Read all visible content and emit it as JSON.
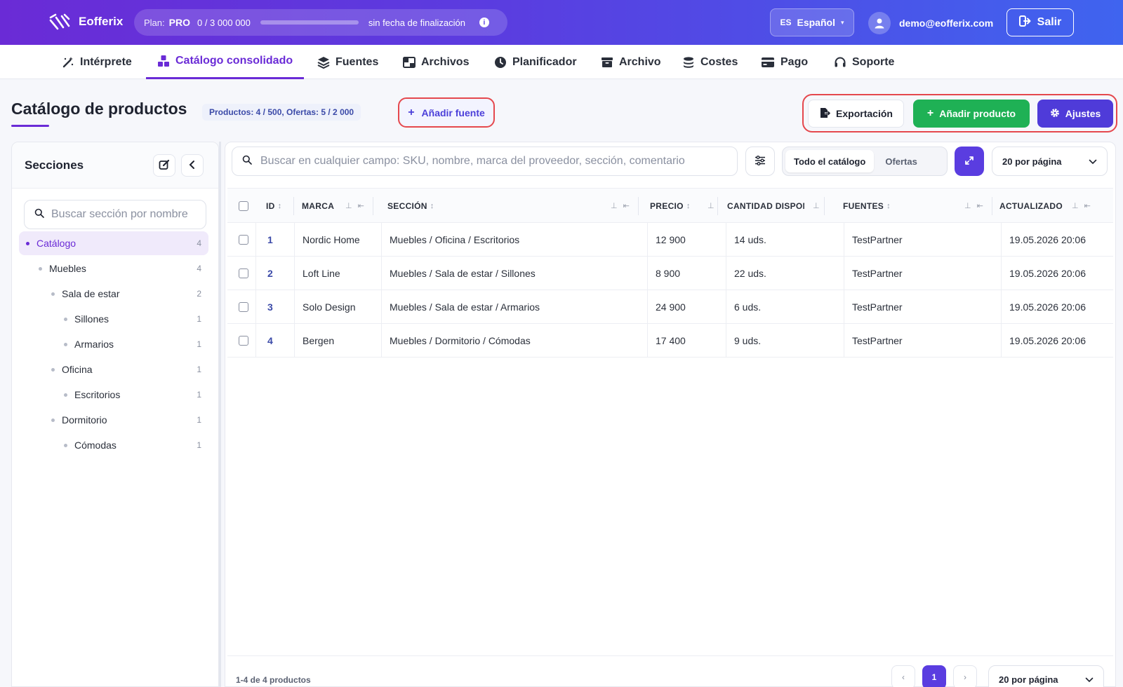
{
  "app": {
    "name": "Eofferix"
  },
  "plan": {
    "label": "Plan:",
    "tier": "PRO",
    "usage": "0  /  3 000 000",
    "usage_fraction": 0,
    "expiry": "sin fecha de finalización"
  },
  "language": {
    "code": "ES",
    "name": "Español"
  },
  "user": {
    "email": "demo@eofferix.com"
  },
  "logout_label": "Salir",
  "nav": [
    {
      "label": "Intérprete",
      "icon": "magic-wand-icon"
    },
    {
      "label": "Catálogo consolidado",
      "icon": "catalog-icon",
      "active": true
    },
    {
      "label": "Fuentes",
      "icon": "layers-icon"
    },
    {
      "label": "Archivos",
      "icon": "files-icon"
    },
    {
      "label": "Planificador",
      "icon": "clock-icon"
    },
    {
      "label": "Archivo",
      "icon": "archive-icon"
    },
    {
      "label": "Costes",
      "icon": "coins-icon"
    },
    {
      "label": "Pago",
      "icon": "credit-card-icon"
    },
    {
      "label": "Soporte",
      "icon": "headset-icon"
    }
  ],
  "page": {
    "title": "Catálogo de productos",
    "counts": "Productos: 4 / 500, Ofertas: 5 / 2 000",
    "add_source": "Añadir fuente",
    "export": "Exportación",
    "add_product": "Añadir producto",
    "settings": "Ajustes"
  },
  "sidebar": {
    "title": "Secciones",
    "search_placeholder": "Buscar sección por nombre",
    "tree": [
      {
        "label": "Catálogo",
        "count": "4",
        "selected": true
      },
      {
        "label": "Muebles",
        "count": "4"
      },
      {
        "label": "Sala de estar",
        "count": "2"
      },
      {
        "label": "Sillones",
        "count": "1"
      },
      {
        "label": "Armarios",
        "count": "1"
      },
      {
        "label": "Oficina",
        "count": "1"
      },
      {
        "label": "Escritorios",
        "count": "1"
      },
      {
        "label": "Dormitorio",
        "count": "1"
      },
      {
        "label": "Cómodas",
        "count": "1"
      }
    ]
  },
  "toolbar": {
    "search_placeholder": "Buscar en cualquier campo: SKU, nombre, marca del proveedor, sección, comentario",
    "scope_all": "Todo el catálogo",
    "scope_offers": "Ofertas",
    "per_page": "20 por página"
  },
  "table": {
    "headers": [
      "ID",
      "MARCA",
      "SECCIÓN",
      "PRECIO",
      "CANTIDAD DISPONIBLE",
      "FUENTES",
      "ACTUALIZADO"
    ],
    "rows": [
      [
        "1",
        "Nordic Home",
        "Muebles / Oficina / Escritorios",
        "12 900",
        "14 uds.",
        "TestPartner",
        "19.05.2026 20:06"
      ],
      [
        "2",
        "Loft Line",
        "Muebles / Sala de estar / Sillones",
        "8 900",
        "22 uds.",
        "TestPartner",
        "19.05.2026 20:06"
      ],
      [
        "3",
        "Solo Design",
        "Muebles / Sala de estar / Armarios",
        "24 900",
        "6 uds.",
        "TestPartner",
        "19.05.2026 20:06"
      ],
      [
        "4",
        "Bergen",
        "Muebles / Dormitorio / Cómodas",
        "17 400",
        "9 uds.",
        "TestPartner",
        "19.05.2026 20:06"
      ]
    ]
  },
  "footer": {
    "summary": "1-4 de 4 productos",
    "page": "1",
    "prev": "‹",
    "next": "›",
    "per_page": "20 por página"
  }
}
